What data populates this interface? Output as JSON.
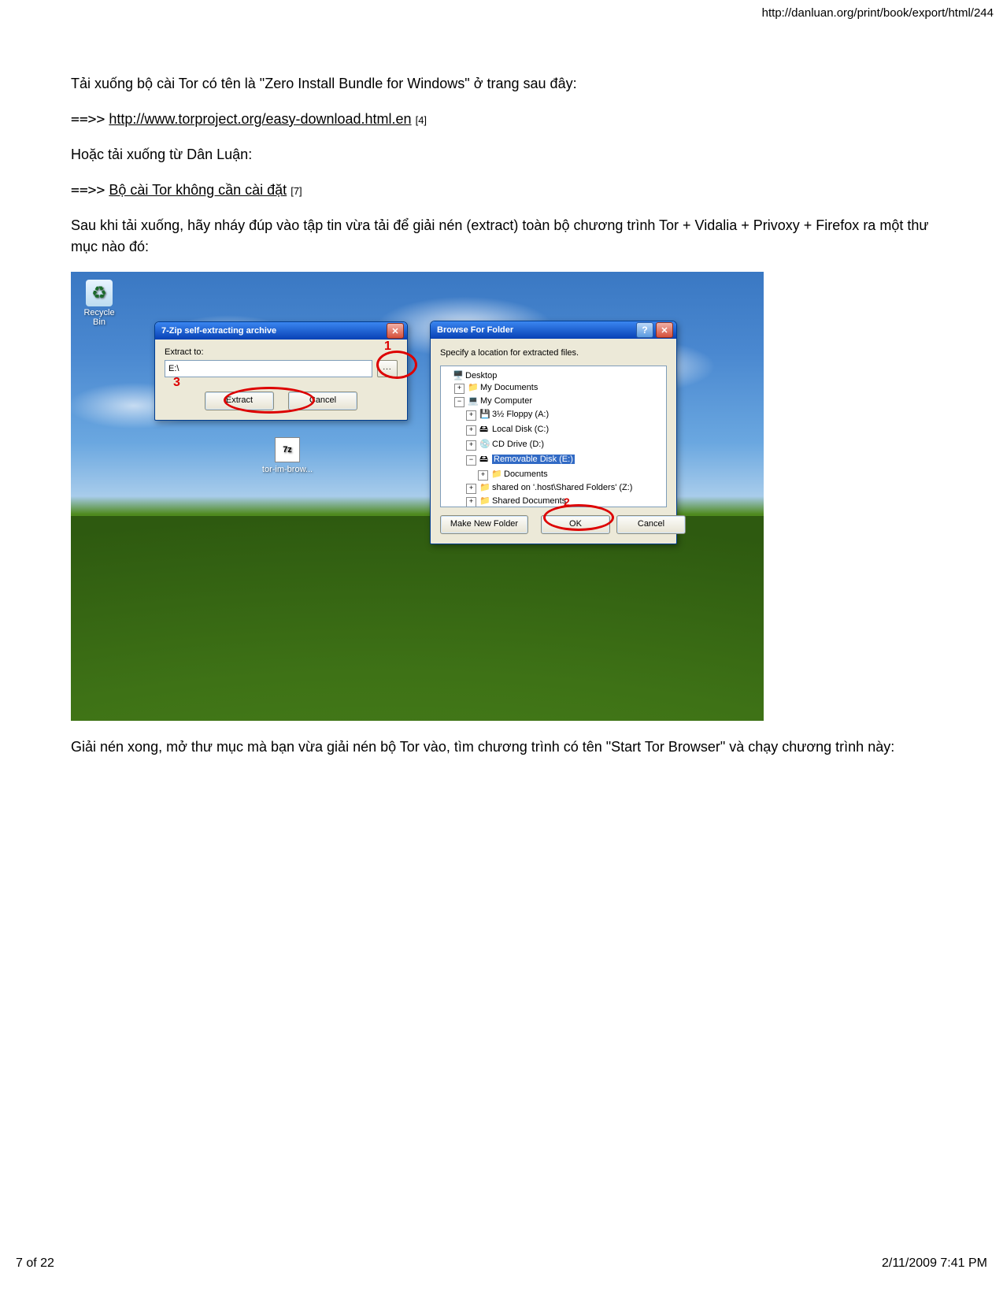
{
  "header": {
    "url": "http://danluan.org/print/book/export/html/244"
  },
  "p1": "Tải xuống bộ cài Tor có tên là \"Zero Install Bundle for Windows\" ở trang sau đây:",
  "arrow": "==>>",
  "link1": {
    "text": "http://www.torproject.org/easy-download.html.en",
    "ref": "[4]"
  },
  "p2": "Hoặc tải xuống từ Dân Luận:",
  "link2": {
    "text": "Bộ cài Tor không cần cài đặt",
    "ref": "[7]"
  },
  "p3": "Sau khi tải xuống, hãy nháy đúp vào tập tin vừa tải để giải nén (extract) toàn bộ chương trình Tor + Vidalia + Privoxy + Firefox ra một thư mục nào đó:",
  "p4": "Giải nén xong, mở thư mục mà bạn vừa giải nén bộ Tor vào, tìm chương trình có tên \"Start Tor Browser\" và chạy chương trình này:",
  "desktop": {
    "recycle": {
      "label": "Recycle Bin"
    },
    "file": {
      "box": "7z",
      "label": "tor-im-brow..."
    }
  },
  "zip": {
    "title": "7-Zip self-extracting archive",
    "extract_label": "Extract to:",
    "path": "E:\\",
    "browse": "...",
    "extract_btn": "Extract",
    "cancel_btn": "Cancel"
  },
  "bff": {
    "title": "Browse For Folder",
    "msg": "Specify a location for extracted files.",
    "items": [
      {
        "indent": 0,
        "pm": "",
        "icon": "🖥️",
        "label": "Desktop"
      },
      {
        "indent": 1,
        "pm": "+",
        "icon": "📁",
        "label": "My Documents"
      },
      {
        "indent": 1,
        "pm": "−",
        "icon": "💻",
        "label": "My Computer"
      },
      {
        "indent": 2,
        "pm": "+",
        "icon": "💾",
        "label": "3½ Floppy (A:)"
      },
      {
        "indent": 2,
        "pm": "+",
        "icon": "🖴",
        "label": "Local Disk (C:)"
      },
      {
        "indent": 2,
        "pm": "+",
        "icon": "💿",
        "label": "CD Drive (D:)"
      },
      {
        "indent": 2,
        "pm": "−",
        "icon": "🖴",
        "label": "Removable Disk (E:)",
        "selected": true
      },
      {
        "indent": 3,
        "pm": "+",
        "icon": "📁",
        "label": "Documents"
      },
      {
        "indent": 2,
        "pm": "+",
        "icon": "📁",
        "label": "shared on '.host\\Shared Folders' (Z:)"
      },
      {
        "indent": 2,
        "pm": "+",
        "icon": "📁",
        "label": "Shared Documents"
      }
    ],
    "make_new": "Make New Folder",
    "ok": "OK",
    "cancel": "Cancel"
  },
  "anno": {
    "a1": "1",
    "a2": "2",
    "a3": "3"
  },
  "footer": {
    "page": "7 of 22",
    "date": "2/11/2009 7:41 PM"
  }
}
